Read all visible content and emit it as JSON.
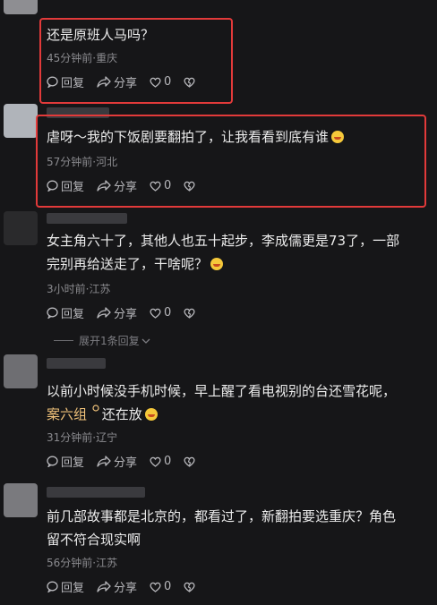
{
  "actions": {
    "reply": "回复",
    "share": "分享",
    "like_count": "0"
  },
  "comments": [
    {
      "text": "还是原班人马吗？",
      "meta": "45分钟前·重庆"
    },
    {
      "text": "虐呀～我的下饭剧要翻拍了，让我看看到底有谁",
      "meta": "57分钟前·河北"
    },
    {
      "text_line1": "女主角六十了，其他人也五十起步，李成儒更是73了，一部",
      "text_line2": "完别再给送走了，干啥呢？",
      "meta": "3小时前·江苏",
      "replies": "展开1条回复"
    },
    {
      "text_line1": "以前小时候没手机时候，早上醒了看电视别的台还雪花呢，",
      "tag": "案六组",
      "text_line2_rest": "还在放",
      "meta": "31分钟前·辽宁"
    },
    {
      "text_line1": "前几部故事都是北京的，都看过了，新翻拍要选重庆？角色",
      "text_line2": "留不符合现实啊",
      "meta": "56分钟前·江苏"
    }
  ],
  "colors": {
    "background": "#161618",
    "highlight_border": "#e23a3a",
    "tag_color": "#f0c27a"
  }
}
